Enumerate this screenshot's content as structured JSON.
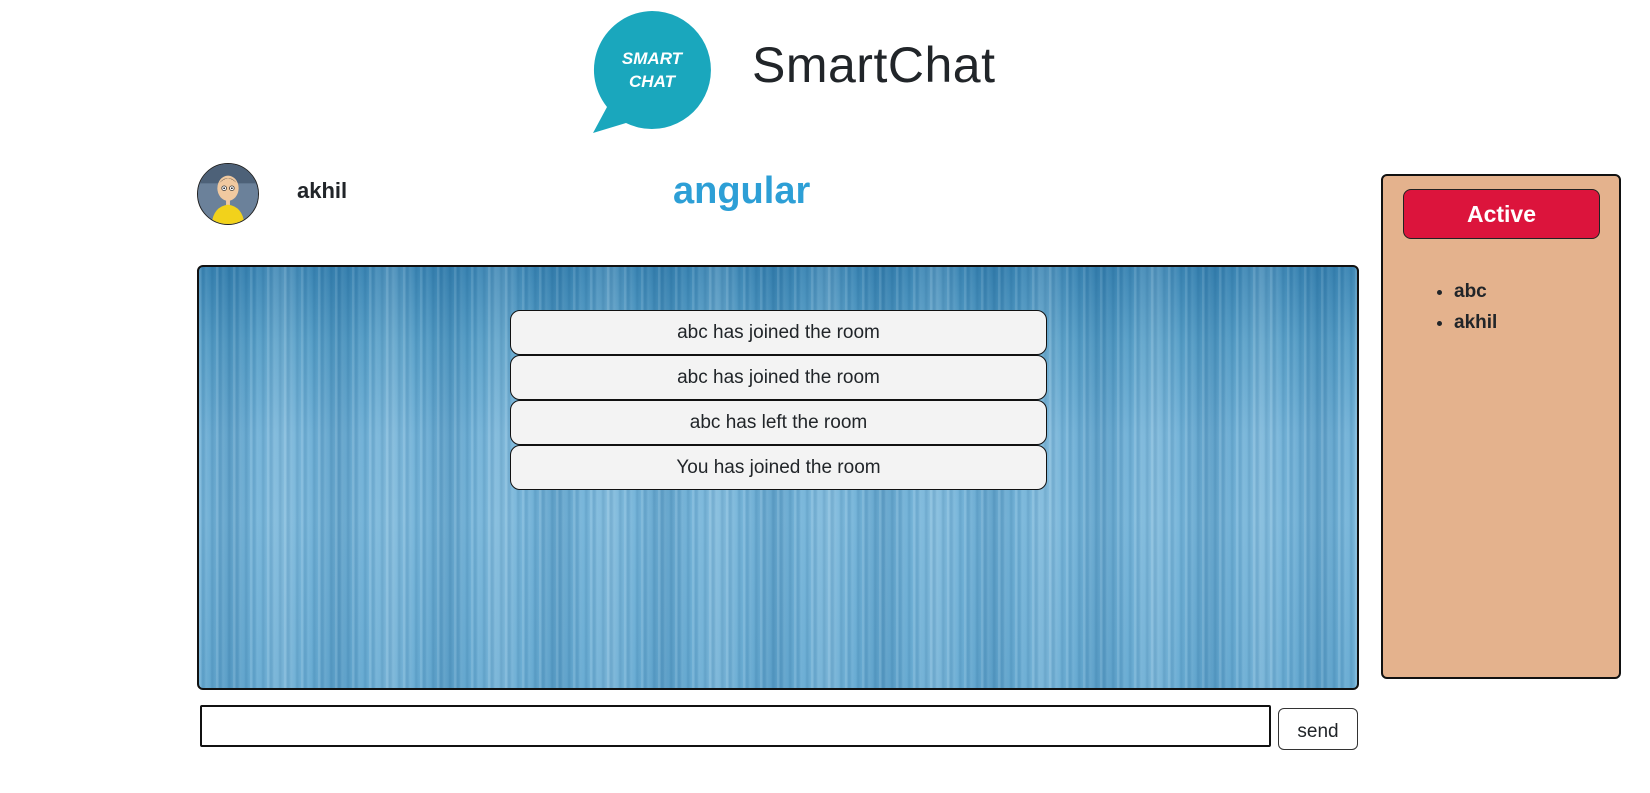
{
  "header": {
    "app_title": "SmartChat",
    "logo": {
      "icon": "speech-bubble-logo",
      "line1": "SMART",
      "line2": "CHAT",
      "color": "#1aa7bd"
    }
  },
  "room": {
    "username": "akhil",
    "avatar_icon": "user-avatar",
    "room_name": "angular",
    "room_name_color": "#2d9fd6"
  },
  "chat": {
    "messages": [
      "abc has joined the room",
      "abc has joined the room",
      "abc has left the room",
      "You has joined the room"
    ],
    "input": {
      "value": "",
      "placeholder": ""
    },
    "send_label": "send"
  },
  "active_panel": {
    "title": "Active",
    "title_color": "#dc143c",
    "background_color": "#e4b28d",
    "users": [
      "abc",
      "akhil"
    ]
  }
}
